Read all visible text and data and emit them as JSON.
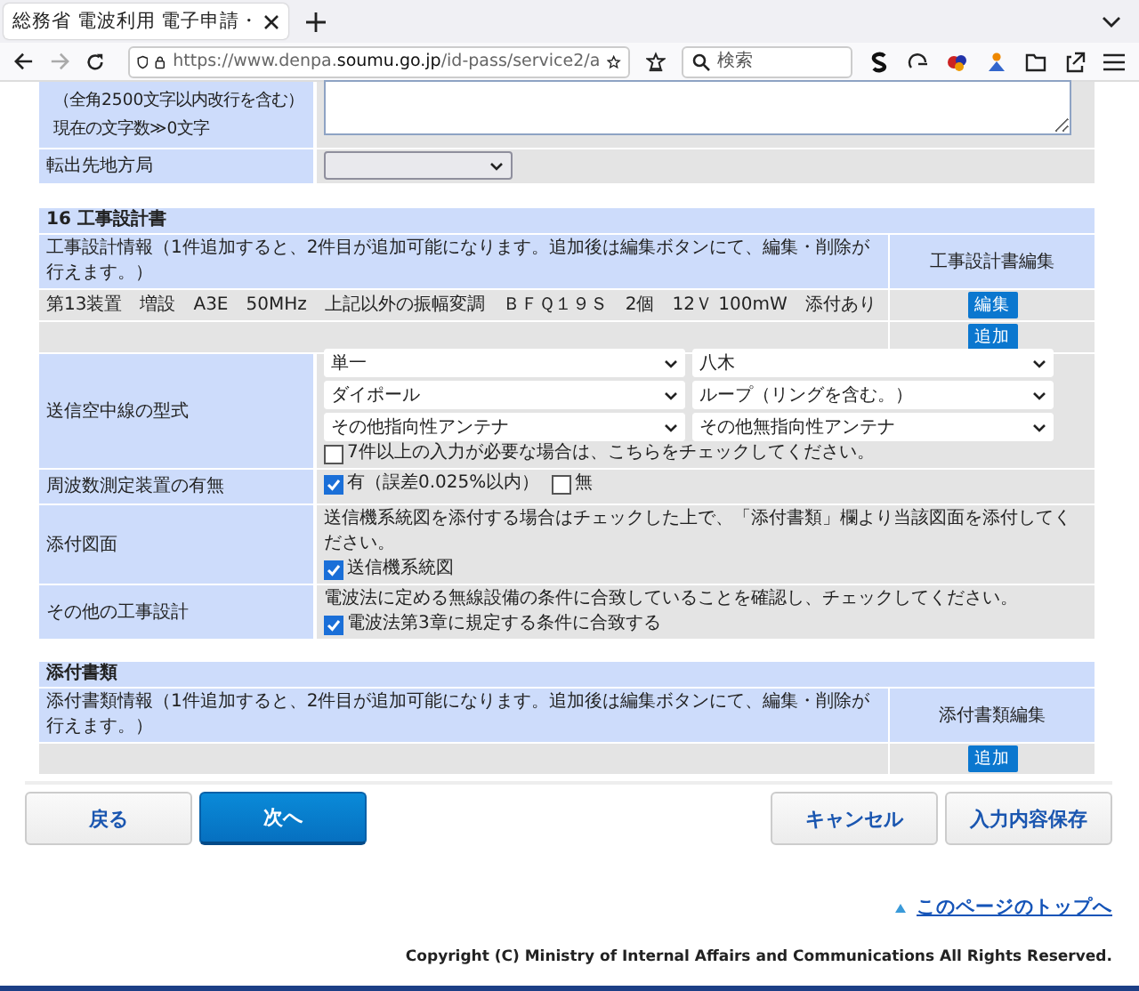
{
  "browser": {
    "tab_title": "総務省 電波利用 電子申請・",
    "url_prefix": "https://www.denpa.",
    "url_domain": "soumu.go.jp",
    "url_path": "/id-pass/service2/a",
    "search_placeholder": "検索"
  },
  "remarks": {
    "label_lines": [
      "（全角2500文字以内改行を含む）",
      "現在の文字数≫0文字"
    ]
  },
  "transfer": {
    "label": "転出先地方局"
  },
  "design": {
    "title": "16 工事設計書",
    "info": "工事設計情報（1件追加すると、2件目が追加可能になります。追加後は編集ボタンにて、編集・削除が行えます。）",
    "edit_header": "工事設計書編集",
    "entries": [
      {
        "text": "第13装置　増設　A3E　50MHz　上記以外の振幅変調　ＢＦＱ１９Ｓ　2個　12Ｖ 100mW　添付あり",
        "button": "編集"
      }
    ],
    "add_button": "追加",
    "antenna": {
      "label": "送信空中線の型式",
      "selects": [
        "単一",
        "八木",
        "ダイポール",
        "ループ（リングを含む。）",
        "その他指向性アンテナ",
        "その他無指向性アンテナ"
      ],
      "more": {
        "label": "7件以上の入力が必要な場合は、こちらをチェックしてください。",
        "checked": false
      }
    },
    "frequency": {
      "label": "周波数測定装置の有無",
      "options": [
        {
          "label": "有（誤差0.025%以内）",
          "checked": true
        },
        {
          "label": "無",
          "checked": false
        }
      ]
    },
    "drawings": {
      "label": "添付図面",
      "note": "送信機系統図を添付する場合はチェックした上で、「添付書類」欄より当該図面を添付してください。",
      "option": {
        "label": "送信機系統図",
        "checked": true
      }
    },
    "other": {
      "label": "その他の工事設計",
      "note": "電波法に定める無線設備の条件に合致していることを確認し、チェックしてください。",
      "option": {
        "label": "電波法第3章に規定する条件に合致する",
        "checked": true
      }
    }
  },
  "attachments": {
    "title": "添付書類",
    "info": "添付書類情報（1件追加すると、2件目が追加可能になります。追加後は編集ボタンにて、編集・削除が行えます。）",
    "edit_header": "添付書類編集",
    "add_button": "追加"
  },
  "buttons": [
    {
      "label": "戻る",
      "kind": "secondary"
    },
    {
      "label": "次へ",
      "kind": "primary"
    },
    {
      "label": "キャンセル",
      "kind": "secondary"
    },
    {
      "label": "入力内容保存",
      "kind": "secondary"
    }
  ],
  "page_top_link": "このページのトップへ",
  "copyright": "Copyright (C) Ministry of Internal Affairs and Communications All Rights Reserved."
}
